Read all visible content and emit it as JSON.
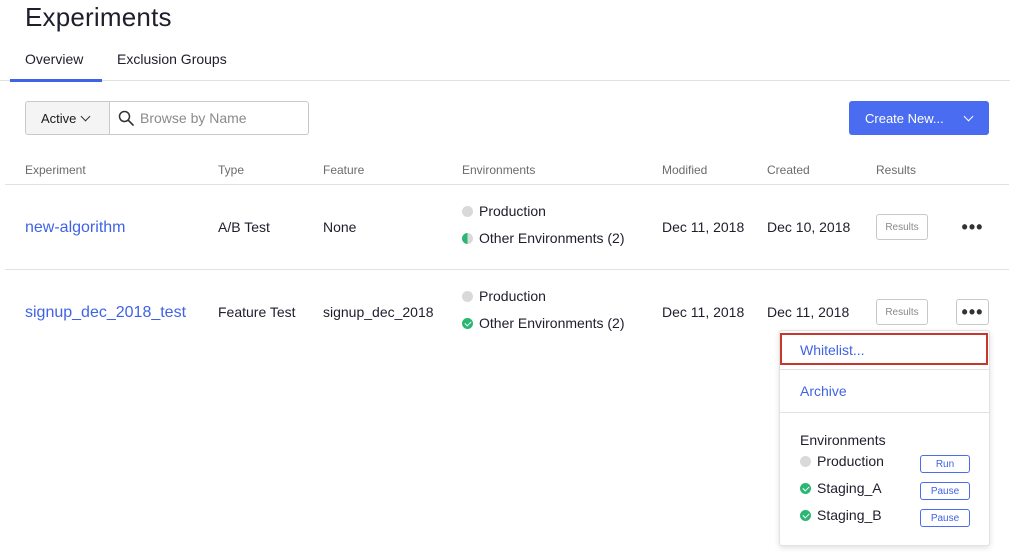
{
  "page": {
    "title": "Experiments"
  },
  "tabs": [
    {
      "label": "Overview",
      "active": true
    },
    {
      "label": "Exclusion Groups",
      "active": false
    }
  ],
  "toolbar": {
    "filter_label": "Active",
    "search_placeholder": "Browse by Name",
    "search_value": "",
    "create_label": "Create New..."
  },
  "table": {
    "columns": [
      "Experiment",
      "Type",
      "Feature",
      "Environments",
      "Modified",
      "Created",
      "Results"
    ],
    "rows": [
      {
        "name": "new-algorithm",
        "type": "A/B Test",
        "feature": "None",
        "environments": [
          {
            "label": "Production",
            "status": "off"
          },
          {
            "label": "Other Environments (2)",
            "status": "partial"
          }
        ],
        "modified": "Dec 11, 2018",
        "created": "Dec 10, 2018",
        "results_label": "Results"
      },
      {
        "name": "signup_dec_2018_test",
        "type": "Feature Test",
        "feature": "signup_dec_2018",
        "environments": [
          {
            "label": "Production",
            "status": "off"
          },
          {
            "label": "Other Environments (2)",
            "status": "running"
          }
        ],
        "modified": "Dec 11, 2018",
        "created": "Dec 11, 2018",
        "results_label": "Results"
      }
    ]
  },
  "more_menu_glyph": "•••",
  "dropdown_menu": {
    "items": [
      {
        "label": "Whitelist...",
        "focused": true
      },
      {
        "label": "Archive",
        "focused": false
      }
    ],
    "environments_heading": "Environments",
    "environments": [
      {
        "label": "Production",
        "status": "off",
        "action": "Run"
      },
      {
        "label": "Staging_A",
        "status": "running",
        "action": "Pause"
      },
      {
        "label": "Staging_B",
        "status": "running",
        "action": "Pause"
      }
    ]
  },
  "colors": {
    "accent": "#3f63e6",
    "primary_button": "#4a6cf0",
    "running": "#2bb673",
    "off": "#d9d9d9",
    "focus_outline": "#c8372d"
  }
}
